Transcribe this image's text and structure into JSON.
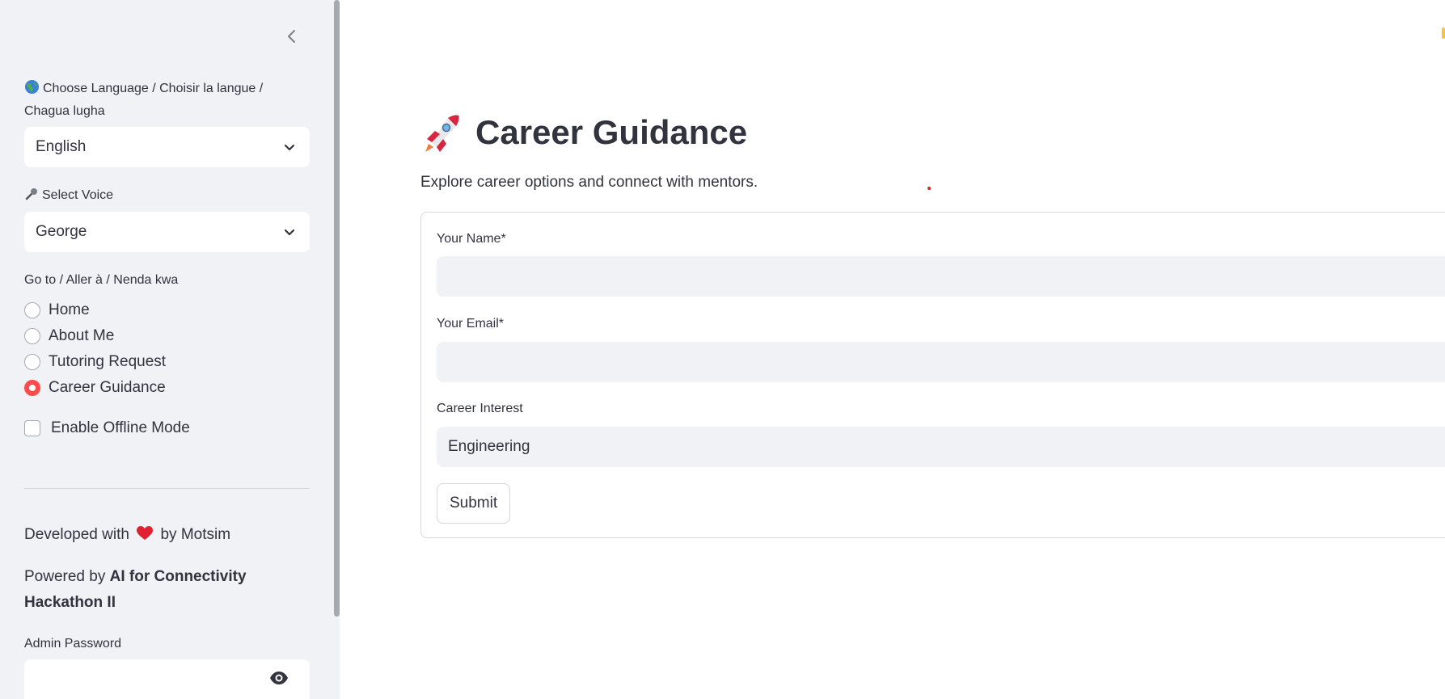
{
  "sidebar": {
    "collapse_icon": "chevron-left-icon",
    "language_label": "Choose Language / Choisir la langue / Chagua lugha",
    "language_icon": "globe-icon",
    "language_value": "English",
    "voice_label": "Select Voice",
    "voice_icon": "microphone-icon",
    "voice_value": "George",
    "nav_label": "Go to / Aller à / Nenda kwa",
    "nav_items": [
      {
        "label": "Home",
        "selected": false
      },
      {
        "label": "About Me",
        "selected": false
      },
      {
        "label": "Tutoring Request",
        "selected": false
      },
      {
        "label": "Career Guidance",
        "selected": true
      }
    ],
    "offline_label": "Enable Offline Mode",
    "developed_prefix": "Developed with",
    "developed_suffix": "by Motsim",
    "heart_icon": "heart-icon",
    "powered_prefix": "Powered by",
    "powered_bold": "AI for Connectivity Hackathon II",
    "admin_password_label": "Admin Password",
    "eye_icon": "eye-icon"
  },
  "main": {
    "title_icon": "rocket-icon",
    "title": "Career Guidance",
    "subtitle": "Explore career options and connect with mentors.",
    "form": {
      "name_label": "Your Name*",
      "name_value": "",
      "email_label": "Your Email*",
      "email_value": "",
      "career_label": "Career Interest",
      "career_value": "Engineering",
      "submit_label": "Submit"
    }
  },
  "colors": {
    "accent": "#ff4b4b",
    "sidebar_bg": "#f0f2f6",
    "text": "#31333f"
  }
}
